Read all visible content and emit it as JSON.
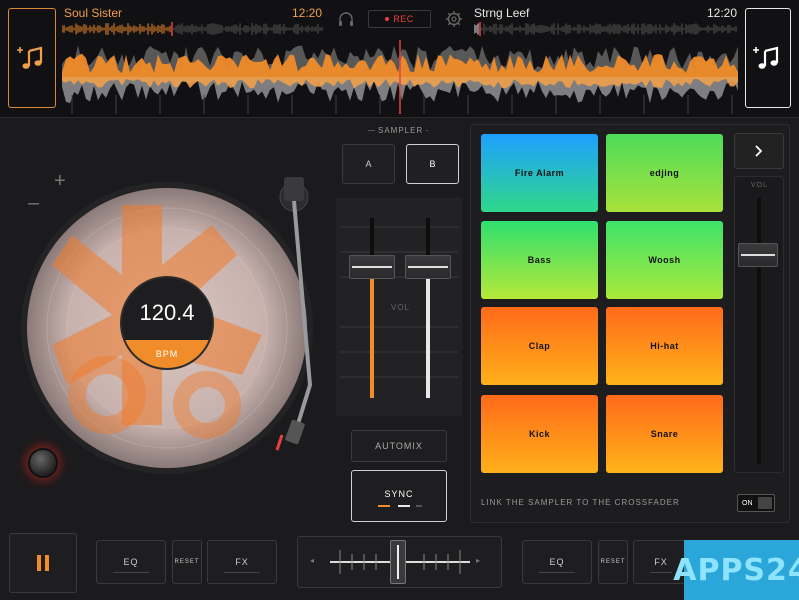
{
  "deck_a": {
    "title": "Soul Sister",
    "time": "12:20",
    "load_icon": "music-note-plus-icon"
  },
  "deck_b": {
    "title": "Strng Leef",
    "time": "12:20",
    "load_icon": "music-note-plus-icon"
  },
  "header": {
    "rec_label": "REC",
    "headphone_icon": "headphone-icon",
    "settings_icon": "gear-icon"
  },
  "turntable": {
    "bpm_value": "120.4",
    "bpm_label": "BPM",
    "pitch_plus": "+",
    "pitch_minus": "–"
  },
  "mixer": {
    "sampler_label": "SAMPLER",
    "sampler_a": "A",
    "sampler_b": "B",
    "vol_label": "VOL",
    "automix_label": "AUTOMIX",
    "sync_label": "SYNC"
  },
  "sampler": {
    "pads": [
      {
        "label": "Fire Alarm",
        "color_top": "#1ea0ff",
        "color_bottom": "#2fd88a"
      },
      {
        "label": "edjing",
        "color_top": "#4ddc5a",
        "color_bottom": "#a8e23a"
      },
      {
        "label": "Bass",
        "color_top": "#2fe070",
        "color_bottom": "#b6e838"
      },
      {
        "label": "Woosh",
        "color_top": "#3ee36a",
        "color_bottom": "#a9e83a"
      },
      {
        "label": "Clap",
        "color_top": "#ff6a1a",
        "color_bottom": "#ffb01a"
      },
      {
        "label": "Hi-hat",
        "color_top": "#ff6a1a",
        "color_bottom": "#ffb41a"
      },
      {
        "label": "Kick",
        "color_top": "#ff6a1a",
        "color_bottom": "#ffb01a"
      },
      {
        "label": "Snare",
        "color_top": "#ff6a1a",
        "color_bottom": "#ffb41a"
      }
    ],
    "link_label": "LINK THE SAMPLER TO THE CROSSFADER",
    "link_toggle": "ON",
    "next_icon": "chevron-right-icon",
    "vol_label": "VOL"
  },
  "bottom": {
    "play_icon": "pause-icon",
    "eq_a": "EQ",
    "reset_a": "RESET",
    "fx_a": "FX",
    "eq_b": "EQ",
    "reset_b": "RESET",
    "fx_b": "FX",
    "cf_left": "◂",
    "cf_right": "▸"
  },
  "watermark": "APPS24",
  "colors": {
    "accent_orange": "#f08c2a",
    "accent_white": "#e8e8e8",
    "rec_red": "#e84040"
  }
}
